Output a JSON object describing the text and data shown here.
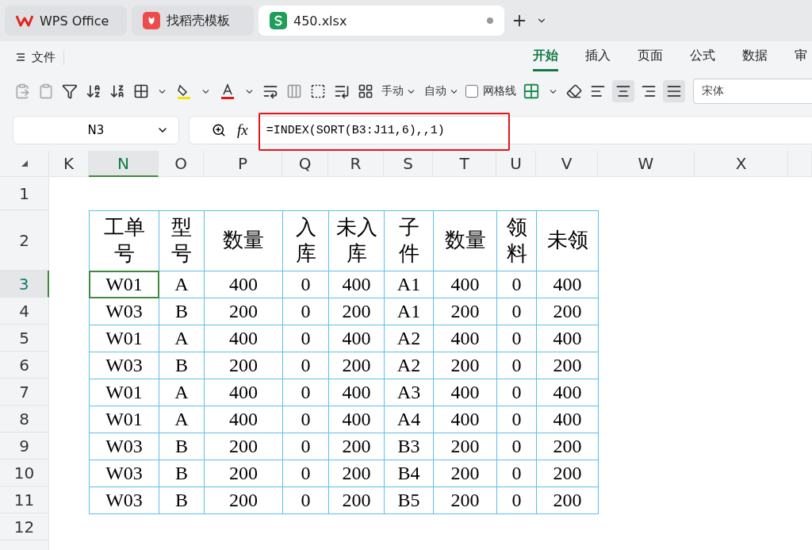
{
  "tabs": [
    {
      "label": "WPS Office",
      "kind": "wps",
      "selected": false
    },
    {
      "label": "找稻壳模板",
      "kind": "docer",
      "selected": false
    },
    {
      "label": "450.xlsx",
      "kind": "sheet",
      "selected": true
    }
  ],
  "menu": {
    "file_label": "文件",
    "ribbon_tabs": [
      {
        "label": "开始",
        "selected": true
      },
      {
        "label": "插入",
        "selected": false
      },
      {
        "label": "页面",
        "selected": false
      },
      {
        "label": "公式",
        "selected": false
      },
      {
        "label": "数据",
        "selected": false
      },
      {
        "label": "审",
        "selected": false
      }
    ]
  },
  "toolbar": {
    "row_height_mode": "手动",
    "column_width_mode": "自动",
    "gridlines": {
      "label": "网格线",
      "checked": false
    },
    "font": "宋体"
  },
  "formula_bar": {
    "name_box": "N3",
    "fx_label": "fx",
    "formula": "=INDEX(SORT(B3:J11,6),,1)"
  },
  "columns": [
    {
      "label": "K",
      "selected": false
    },
    {
      "label": "N",
      "selected": true
    },
    {
      "label": "O",
      "selected": false
    },
    {
      "label": "P",
      "selected": false
    },
    {
      "label": "Q",
      "selected": false
    },
    {
      "label": "R",
      "selected": false
    },
    {
      "label": "S",
      "selected": false
    },
    {
      "label": "T",
      "selected": false
    },
    {
      "label": "U",
      "selected": false
    },
    {
      "label": "V",
      "selected": false
    },
    {
      "label": "W",
      "selected": false
    },
    {
      "label": "X",
      "selected": false
    }
  ],
  "rows": [
    {
      "label": "1",
      "selected": false
    },
    {
      "label": "2",
      "selected": false
    },
    {
      "label": "3",
      "selected": true
    },
    {
      "label": "4",
      "selected": false
    },
    {
      "label": "5",
      "selected": false
    },
    {
      "label": "6",
      "selected": false
    },
    {
      "label": "7",
      "selected": false
    },
    {
      "label": "8",
      "selected": false
    },
    {
      "label": "9",
      "selected": false
    },
    {
      "label": "10",
      "selected": false
    },
    {
      "label": "11",
      "selected": false
    },
    {
      "label": "12",
      "selected": false
    }
  ],
  "table": {
    "header": [
      "工单号",
      "型号",
      "数量",
      "入库",
      "未入库",
      "子件",
      "数量",
      "领料",
      "未领"
    ],
    "rows": [
      [
        {
          "text": "W01",
          "selected": true
        },
        {
          "text": "A",
          "selected": false
        },
        {
          "text": "400",
          "selected": false
        },
        {
          "text": "0",
          "selected": false
        },
        {
          "text": "400",
          "selected": false
        },
        {
          "text": "A1",
          "selected": false
        },
        {
          "text": "400",
          "selected": false
        },
        {
          "text": "0",
          "selected": false
        },
        {
          "text": "400",
          "selected": false
        }
      ],
      [
        {
          "text": "W03",
          "selected": false
        },
        {
          "text": "B",
          "selected": false
        },
        {
          "text": "200",
          "selected": false
        },
        {
          "text": "0",
          "selected": false
        },
        {
          "text": "200",
          "selected": false
        },
        {
          "text": "A1",
          "selected": false
        },
        {
          "text": "200",
          "selected": false
        },
        {
          "text": "0",
          "selected": false
        },
        {
          "text": "200",
          "selected": false
        }
      ],
      [
        {
          "text": "W01",
          "selected": false
        },
        {
          "text": "A",
          "selected": false
        },
        {
          "text": "400",
          "selected": false
        },
        {
          "text": "0",
          "selected": false
        },
        {
          "text": "400",
          "selected": false
        },
        {
          "text": "A2",
          "selected": false
        },
        {
          "text": "400",
          "selected": false
        },
        {
          "text": "0",
          "selected": false
        },
        {
          "text": "400",
          "selected": false
        }
      ],
      [
        {
          "text": "W03",
          "selected": false
        },
        {
          "text": "B",
          "selected": false
        },
        {
          "text": "200",
          "selected": false
        },
        {
          "text": "0",
          "selected": false
        },
        {
          "text": "200",
          "selected": false
        },
        {
          "text": "A2",
          "selected": false
        },
        {
          "text": "200",
          "selected": false
        },
        {
          "text": "0",
          "selected": false
        },
        {
          "text": "200",
          "selected": false
        }
      ],
      [
        {
          "text": "W01",
          "selected": false
        },
        {
          "text": "A",
          "selected": false
        },
        {
          "text": "400",
          "selected": false
        },
        {
          "text": "0",
          "selected": false
        },
        {
          "text": "400",
          "selected": false
        },
        {
          "text": "A3",
          "selected": false
        },
        {
          "text": "400",
          "selected": false
        },
        {
          "text": "0",
          "selected": false
        },
        {
          "text": "400",
          "selected": false
        }
      ],
      [
        {
          "text": "W01",
          "selected": false
        },
        {
          "text": "A",
          "selected": false
        },
        {
          "text": "400",
          "selected": false
        },
        {
          "text": "0",
          "selected": false
        },
        {
          "text": "400",
          "selected": false
        },
        {
          "text": "A4",
          "selected": false
        },
        {
          "text": "400",
          "selected": false
        },
        {
          "text": "0",
          "selected": false
        },
        {
          "text": "400",
          "selected": false
        }
      ],
      [
        {
          "text": "W03",
          "selected": false
        },
        {
          "text": "B",
          "selected": false
        },
        {
          "text": "200",
          "selected": false
        },
        {
          "text": "0",
          "selected": false
        },
        {
          "text": "200",
          "selected": false
        },
        {
          "text": "B3",
          "selected": false
        },
        {
          "text": "200",
          "selected": false
        },
        {
          "text": "0",
          "selected": false
        },
        {
          "text": "200",
          "selected": false
        }
      ],
      [
        {
          "text": "W03",
          "selected": false
        },
        {
          "text": "B",
          "selected": false
        },
        {
          "text": "200",
          "selected": false
        },
        {
          "text": "0",
          "selected": false
        },
        {
          "text": "200",
          "selected": false
        },
        {
          "text": "B4",
          "selected": false
        },
        {
          "text": "200",
          "selected": false
        },
        {
          "text": "0",
          "selected": false
        },
        {
          "text": "200",
          "selected": false
        }
      ],
      [
        {
          "text": "W03",
          "selected": false
        },
        {
          "text": "B",
          "selected": false
        },
        {
          "text": "200",
          "selected": false
        },
        {
          "text": "0",
          "selected": false
        },
        {
          "text": "200",
          "selected": false
        },
        {
          "text": "B5",
          "selected": false
        },
        {
          "text": "200",
          "selected": false
        },
        {
          "text": "0",
          "selected": false
        },
        {
          "text": "200",
          "selected": false
        }
      ]
    ]
  }
}
